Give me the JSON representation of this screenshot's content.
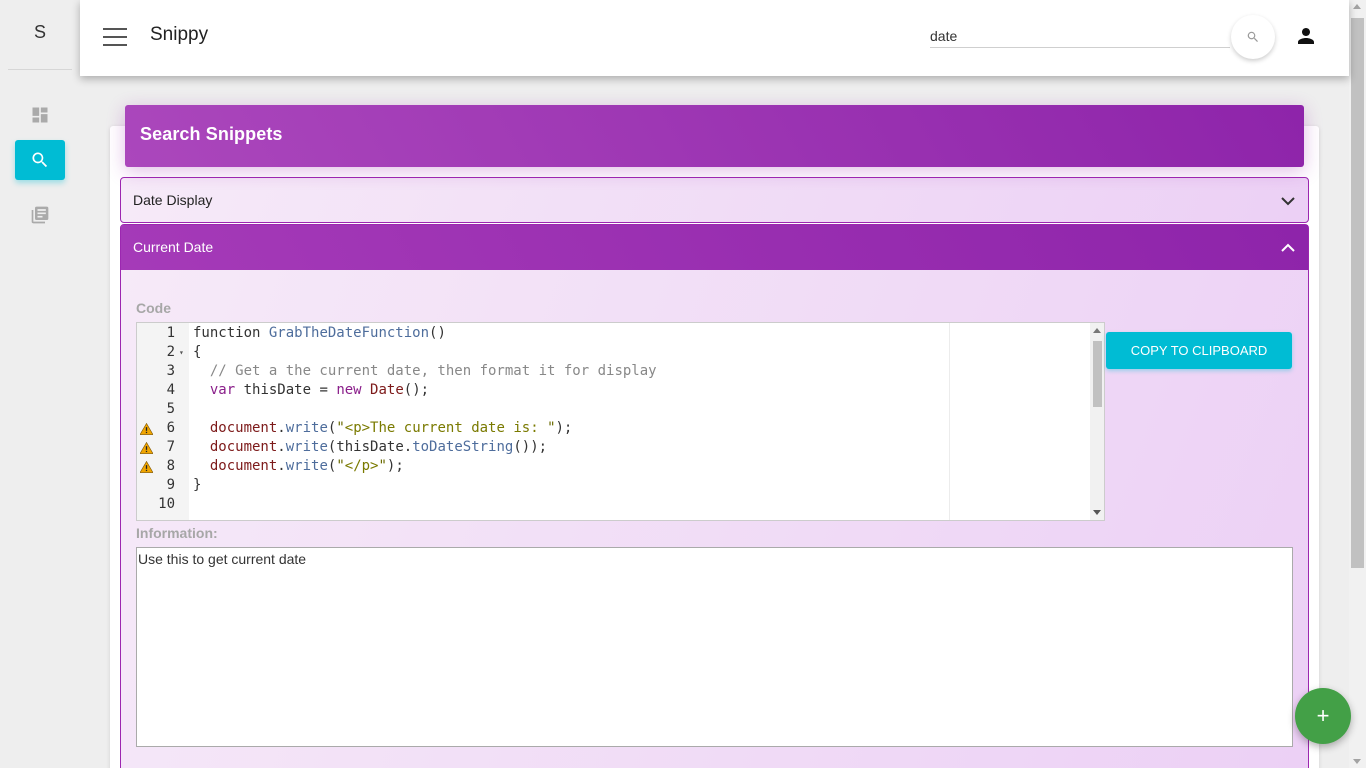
{
  "sidebar": {
    "brand": "S",
    "items": [
      {
        "icon": "dashboard-icon",
        "active": false
      },
      {
        "icon": "search-icon",
        "active": true
      },
      {
        "icon": "library-books-icon",
        "active": false
      }
    ]
  },
  "topbar": {
    "title": "Snippy",
    "search": {
      "value": "date",
      "placeholder": ""
    },
    "search_button_icon": "search-icon",
    "user_icon": "person-icon"
  },
  "card": {
    "title": "Search Snippets"
  },
  "panels": [
    {
      "title": "Date Display",
      "expanded": false
    },
    {
      "title": "Current Date",
      "expanded": true
    }
  ],
  "snippet": {
    "code_label": "Code",
    "code_lines": [
      {
        "n": "1",
        "text": "function GrabTheDateFunction()"
      },
      {
        "n": "2",
        "text": "{"
      },
      {
        "n": "3",
        "text": "  // Get a the current date, then format it for display"
      },
      {
        "n": "4",
        "text": "  var thisDate = new Date();"
      },
      {
        "n": "5",
        "text": ""
      },
      {
        "n": "6",
        "text": "  document.write(\"<p>The current date is: \");"
      },
      {
        "n": "7",
        "text": "  document.write(thisDate.toDateString());"
      },
      {
        "n": "8",
        "text": "  document.write(\"</p>\");"
      },
      {
        "n": "9",
        "text": "}"
      },
      {
        "n": "10",
        "text": ""
      }
    ],
    "copy_button": "COPY TO CLIPBOARD",
    "info_label": "Information:",
    "info_text": "Use this to get current date"
  },
  "fab": {
    "label": "+"
  },
  "colors": {
    "accent": "#00bcd4",
    "header_purple": "#9c27b0",
    "fab_green": "#43a047"
  }
}
